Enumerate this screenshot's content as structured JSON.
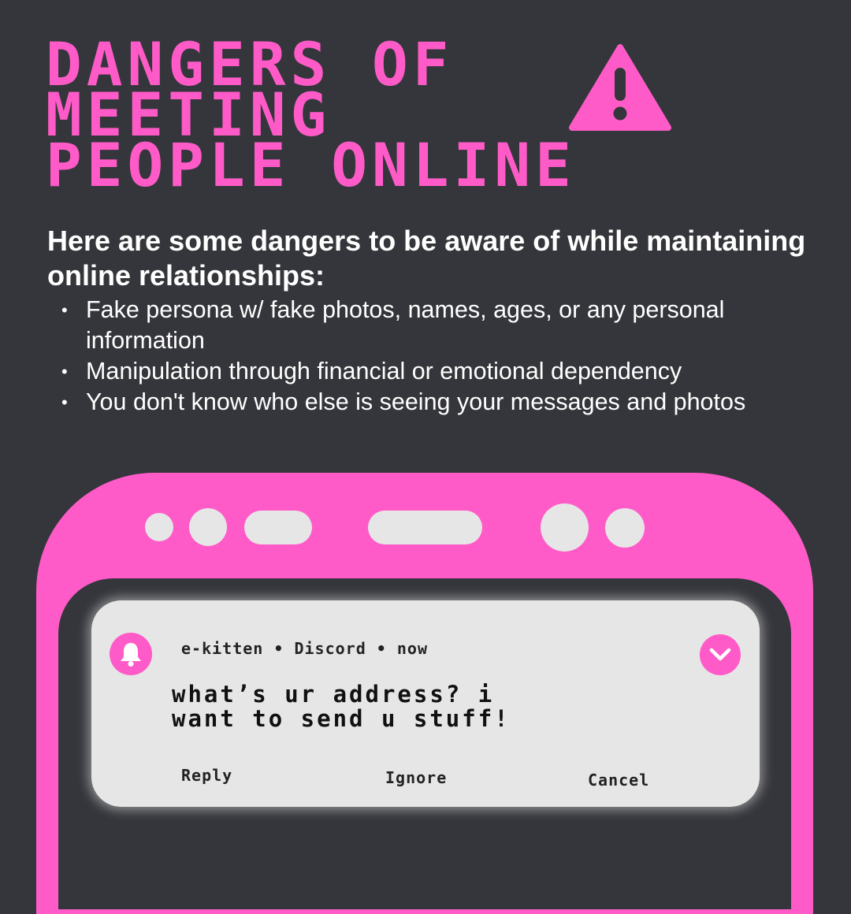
{
  "headline": {
    "lines": [
      "DANGERS OF",
      "MEETING",
      "PEOPLE ONLINE"
    ],
    "icon": "warning-icon"
  },
  "intro": "Here are some dangers to be aware of while maintaining online relationships:",
  "dangers": [
    "Fake persona w/ fake photos, names, ages, or any personal information",
    "Manipulation through financial or emotional dependency",
    "You don't know who else is seeing your messages and photos"
  ],
  "notification": {
    "icon": "bell-icon",
    "meta": "e-kitten • Discord • now",
    "message_lines": [
      "what’s ur address? i",
      "want to send u stuff!"
    ],
    "expand_icon": "chevron-down-icon",
    "actions": {
      "reply": "Reply",
      "ignore": "Ignore",
      "cancel": "Cancel"
    }
  },
  "colors": {
    "background": "#35363b",
    "accent": "#ff5bc8",
    "card": "#e6e6e6",
    "text": "#ffffff"
  }
}
